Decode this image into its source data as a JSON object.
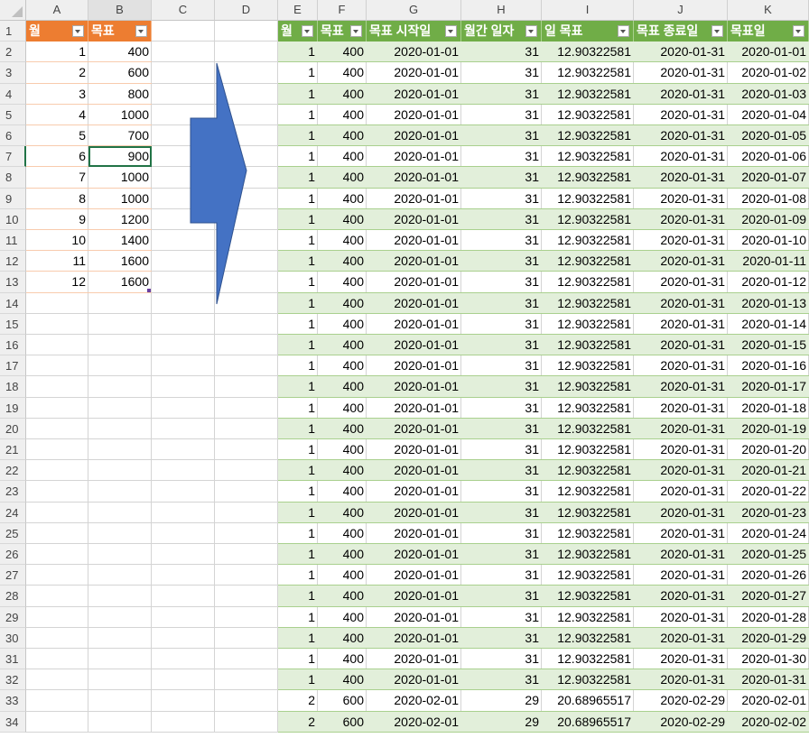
{
  "columns": [
    "A",
    "B",
    "C",
    "D",
    "E",
    "F",
    "G",
    "H",
    "I",
    "J",
    "K"
  ],
  "row_count": 34,
  "active_cell": "B7",
  "table1": {
    "headers": [
      "월",
      "목표"
    ],
    "rows": [
      [
        "1",
        "400"
      ],
      [
        "2",
        "600"
      ],
      [
        "3",
        "800"
      ],
      [
        "4",
        "1000"
      ],
      [
        "5",
        "700"
      ],
      [
        "6",
        "900"
      ],
      [
        "7",
        "1000"
      ],
      [
        "8",
        "1000"
      ],
      [
        "9",
        "1200"
      ],
      [
        "10",
        "1400"
      ],
      [
        "11",
        "1600"
      ],
      [
        "12",
        "1600"
      ]
    ]
  },
  "table2": {
    "headers": [
      "월",
      "목표",
      "목표 시작일",
      "월간 일자",
      "일 목표",
      "목표 종료일",
      "목표일"
    ],
    "rows": [
      [
        "1",
        "400",
        "2020-01-01",
        "31",
        "12.90322581",
        "2020-01-31",
        "2020-01-01"
      ],
      [
        "1",
        "400",
        "2020-01-01",
        "31",
        "12.90322581",
        "2020-01-31",
        "2020-01-02"
      ],
      [
        "1",
        "400",
        "2020-01-01",
        "31",
        "12.90322581",
        "2020-01-31",
        "2020-01-03"
      ],
      [
        "1",
        "400",
        "2020-01-01",
        "31",
        "12.90322581",
        "2020-01-31",
        "2020-01-04"
      ],
      [
        "1",
        "400",
        "2020-01-01",
        "31",
        "12.90322581",
        "2020-01-31",
        "2020-01-05"
      ],
      [
        "1",
        "400",
        "2020-01-01",
        "31",
        "12.90322581",
        "2020-01-31",
        "2020-01-06"
      ],
      [
        "1",
        "400",
        "2020-01-01",
        "31",
        "12.90322581",
        "2020-01-31",
        "2020-01-07"
      ],
      [
        "1",
        "400",
        "2020-01-01",
        "31",
        "12.90322581",
        "2020-01-31",
        "2020-01-08"
      ],
      [
        "1",
        "400",
        "2020-01-01",
        "31",
        "12.90322581",
        "2020-01-31",
        "2020-01-09"
      ],
      [
        "1",
        "400",
        "2020-01-01",
        "31",
        "12.90322581",
        "2020-01-31",
        "2020-01-10"
      ],
      [
        "1",
        "400",
        "2020-01-01",
        "31",
        "12.90322581",
        "2020-01-31",
        "2020-01-11"
      ],
      [
        "1",
        "400",
        "2020-01-01",
        "31",
        "12.90322581",
        "2020-01-31",
        "2020-01-12"
      ],
      [
        "1",
        "400",
        "2020-01-01",
        "31",
        "12.90322581",
        "2020-01-31",
        "2020-01-13"
      ],
      [
        "1",
        "400",
        "2020-01-01",
        "31",
        "12.90322581",
        "2020-01-31",
        "2020-01-14"
      ],
      [
        "1",
        "400",
        "2020-01-01",
        "31",
        "12.90322581",
        "2020-01-31",
        "2020-01-15"
      ],
      [
        "1",
        "400",
        "2020-01-01",
        "31",
        "12.90322581",
        "2020-01-31",
        "2020-01-16"
      ],
      [
        "1",
        "400",
        "2020-01-01",
        "31",
        "12.90322581",
        "2020-01-31",
        "2020-01-17"
      ],
      [
        "1",
        "400",
        "2020-01-01",
        "31",
        "12.90322581",
        "2020-01-31",
        "2020-01-18"
      ],
      [
        "1",
        "400",
        "2020-01-01",
        "31",
        "12.90322581",
        "2020-01-31",
        "2020-01-19"
      ],
      [
        "1",
        "400",
        "2020-01-01",
        "31",
        "12.90322581",
        "2020-01-31",
        "2020-01-20"
      ],
      [
        "1",
        "400",
        "2020-01-01",
        "31",
        "12.90322581",
        "2020-01-31",
        "2020-01-21"
      ],
      [
        "1",
        "400",
        "2020-01-01",
        "31",
        "12.90322581",
        "2020-01-31",
        "2020-01-22"
      ],
      [
        "1",
        "400",
        "2020-01-01",
        "31",
        "12.90322581",
        "2020-01-31",
        "2020-01-23"
      ],
      [
        "1",
        "400",
        "2020-01-01",
        "31",
        "12.90322581",
        "2020-01-31",
        "2020-01-24"
      ],
      [
        "1",
        "400",
        "2020-01-01",
        "31",
        "12.90322581",
        "2020-01-31",
        "2020-01-25"
      ],
      [
        "1",
        "400",
        "2020-01-01",
        "31",
        "12.90322581",
        "2020-01-31",
        "2020-01-26"
      ],
      [
        "1",
        "400",
        "2020-01-01",
        "31",
        "12.90322581",
        "2020-01-31",
        "2020-01-27"
      ],
      [
        "1",
        "400",
        "2020-01-01",
        "31",
        "12.90322581",
        "2020-01-31",
        "2020-01-28"
      ],
      [
        "1",
        "400",
        "2020-01-01",
        "31",
        "12.90322581",
        "2020-01-31",
        "2020-01-29"
      ],
      [
        "1",
        "400",
        "2020-01-01",
        "31",
        "12.90322581",
        "2020-01-31",
        "2020-01-30"
      ],
      [
        "1",
        "400",
        "2020-01-01",
        "31",
        "12.90322581",
        "2020-01-31",
        "2020-01-31"
      ],
      [
        "2",
        "600",
        "2020-02-01",
        "29",
        "20.68965517",
        "2020-02-29",
        "2020-02-01"
      ],
      [
        "2",
        "600",
        "2020-02-01",
        "29",
        "20.68965517",
        "2020-02-29",
        "2020-02-02"
      ]
    ]
  },
  "colors": {
    "table1_header": "#ed7d31",
    "table2_header": "#70ad47",
    "table2_band": "#e2efda",
    "arrow_fill": "#4472c4",
    "arrow_stroke": "#2f528f"
  },
  "icons": {
    "filter": "filter-dropdown-icon",
    "arrow": "right-arrow-shape"
  }
}
